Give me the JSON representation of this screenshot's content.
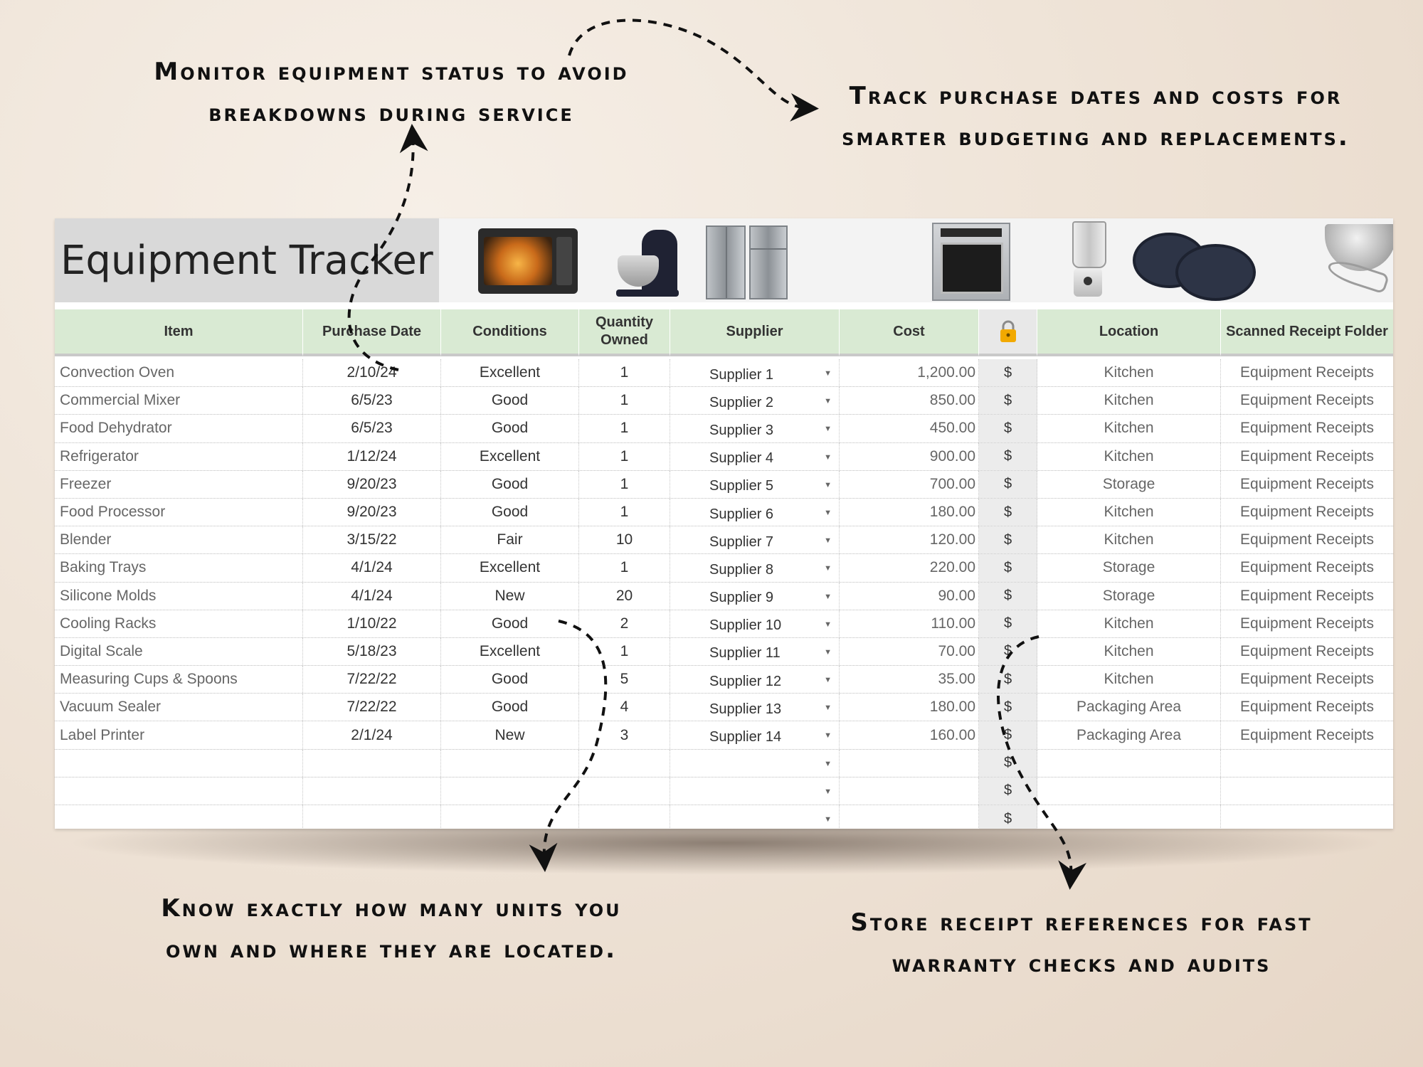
{
  "callouts": {
    "top_left": [
      "Monitor equipment status to avoid",
      "breakdowns during service"
    ],
    "top_right": [
      "Track purchase dates and costs for",
      "smarter budgeting and replacements."
    ],
    "bottom_left": [
      "Know exactly how many units you",
      "own and where they are located."
    ],
    "bottom_right": [
      "Store receipt references for fast",
      "warranty checks and audits"
    ]
  },
  "sheet": {
    "title": "Equipment Tracker",
    "banner_images": [
      "microwave",
      "stand-mixer",
      "refrigerators",
      "wall-oven",
      "blender",
      "baking-pans",
      "mixing-bowl-whisk"
    ],
    "headers": {
      "item": "Item",
      "purchase_date": "Purchase Date",
      "conditions": "Conditions",
      "quantity_line1": "Quantity",
      "quantity_line2": "Owned",
      "supplier": "Supplier",
      "cost": "Cost",
      "lock_icon": "lock-icon",
      "location": "Location",
      "receipt_folder": "Scanned Receipt Folder"
    },
    "rows": [
      {
        "item": "Convection Oven",
        "date": "2/10/24",
        "cond": "Excellent",
        "qty": "1",
        "supplier": "Supplier 1",
        "cost": "1,200.00",
        "cur": "$",
        "loc": "Kitchen",
        "rec": "Equipment Receipts"
      },
      {
        "item": "Commercial Mixer",
        "date": "6/5/23",
        "cond": "Good",
        "qty": "1",
        "supplier": "Supplier 2",
        "cost": "850.00",
        "cur": "$",
        "loc": "Kitchen",
        "rec": "Equipment Receipts"
      },
      {
        "item": "Food Dehydrator",
        "date": "6/5/23",
        "cond": "Good",
        "qty": "1",
        "supplier": "Supplier 3",
        "cost": "450.00",
        "cur": "$",
        "loc": "Kitchen",
        "rec": "Equipment Receipts"
      },
      {
        "item": "Refrigerator",
        "date": "1/12/24",
        "cond": "Excellent",
        "qty": "1",
        "supplier": "Supplier 4",
        "cost": "900.00",
        "cur": "$",
        "loc": "Kitchen",
        "rec": "Equipment Receipts"
      },
      {
        "item": "Freezer",
        "date": "9/20/23",
        "cond": "Good",
        "qty": "1",
        "supplier": "Supplier 5",
        "cost": "700.00",
        "cur": "$",
        "loc": "Storage",
        "rec": "Equipment Receipts"
      },
      {
        "item": "Food Processor",
        "date": "9/20/23",
        "cond": "Good",
        "qty": "1",
        "supplier": "Supplier 6",
        "cost": "180.00",
        "cur": "$",
        "loc": "Kitchen",
        "rec": "Equipment Receipts"
      },
      {
        "item": "Blender",
        "date": "3/15/22",
        "cond": "Fair",
        "qty": "10",
        "supplier": "Supplier 7",
        "cost": "120.00",
        "cur": "$",
        "loc": "Kitchen",
        "rec": "Equipment Receipts"
      },
      {
        "item": "Baking Trays",
        "date": "4/1/24",
        "cond": "Excellent",
        "qty": "1",
        "supplier": "Supplier 8",
        "cost": "220.00",
        "cur": "$",
        "loc": "Storage",
        "rec": "Equipment Receipts"
      },
      {
        "item": "Silicone Molds",
        "date": "4/1/24",
        "cond": "New",
        "qty": "20",
        "supplier": "Supplier 9",
        "cost": "90.00",
        "cur": "$",
        "loc": "Storage",
        "rec": "Equipment Receipts"
      },
      {
        "item": "Cooling Racks",
        "date": "1/10/22",
        "cond": "Good",
        "qty": "2",
        "supplier": "Supplier 10",
        "cost": "110.00",
        "cur": "$",
        "loc": "Kitchen",
        "rec": "Equipment Receipts"
      },
      {
        "item": "Digital Scale",
        "date": "5/18/23",
        "cond": "Excellent",
        "qty": "1",
        "supplier": "Supplier 11",
        "cost": "70.00",
        "cur": "$",
        "loc": "Kitchen",
        "rec": "Equipment Receipts"
      },
      {
        "item": "Measuring Cups & Spoons",
        "date": "7/22/22",
        "cond": "Good",
        "qty": "5",
        "supplier": "Supplier 12",
        "cost": "35.00",
        "cur": "$",
        "loc": "Kitchen",
        "rec": "Equipment Receipts"
      },
      {
        "item": "Vacuum Sealer",
        "date": "7/22/22",
        "cond": "Good",
        "qty": "4",
        "supplier": "Supplier 13",
        "cost": "180.00",
        "cur": "$",
        "loc": "Packaging Area",
        "rec": "Equipment Receipts"
      },
      {
        "item": "Label Printer",
        "date": "2/1/24",
        "cond": "New",
        "qty": "3",
        "supplier": "Supplier 14",
        "cost": "160.00",
        "cur": "$",
        "loc": "Packaging Area",
        "rec": "Equipment Receipts"
      },
      {
        "item": "",
        "date": "",
        "cond": "",
        "qty": "",
        "supplier": "",
        "cost": "",
        "cur": "$",
        "loc": "",
        "rec": ""
      },
      {
        "item": "",
        "date": "",
        "cond": "",
        "qty": "",
        "supplier": "",
        "cost": "",
        "cur": "$",
        "loc": "",
        "rec": ""
      },
      {
        "item": "",
        "date": "",
        "cond": "",
        "qty": "",
        "supplier": "",
        "cost": "",
        "cur": "$",
        "loc": "",
        "rec": ""
      }
    ],
    "dropdown_icon": "chevron-down-icon"
  },
  "colors": {
    "header_bg": "#d9ead3",
    "title_bg": "#d9d9d9",
    "lock_color": "#f2a900",
    "background": "#efe4d8"
  }
}
